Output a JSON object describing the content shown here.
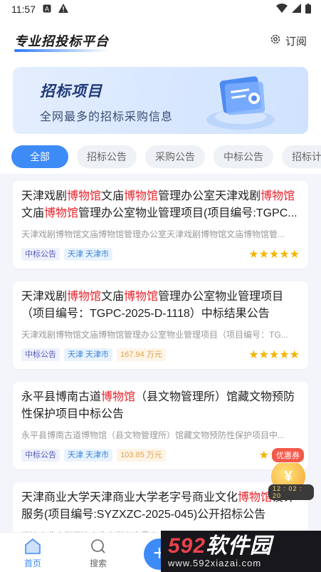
{
  "status_bar": {
    "time": "11:57"
  },
  "header": {
    "title": "专业招投标平台",
    "subscribe_label": "订阅"
  },
  "banner": {
    "title": "招标项目",
    "subtitle": "全网最多的招标采购信息"
  },
  "tabs": [
    "全部",
    "招标公告",
    "采购公告",
    "中标公告",
    "招标计"
  ],
  "cards": [
    {
      "title_parts": [
        {
          "t": "天津戏剧",
          "hl": false
        },
        {
          "t": "博物馆",
          "hl": true
        },
        {
          "t": "文庙",
          "hl": false
        },
        {
          "t": "博物馆",
          "hl": true
        },
        {
          "t": "管理办公室天津戏剧",
          "hl": false
        },
        {
          "t": "博物馆",
          "hl": true
        },
        {
          "t": "文庙",
          "hl": false
        },
        {
          "t": "博物馆",
          "hl": true
        },
        {
          "t": "管理办公室物业管理项目(项目编号:TGPC...",
          "hl": false
        }
      ],
      "desc": "天津戏剧博物馆文庙博物馆管理办公室天津戏剧博物馆文庙博物馆管...",
      "tags": [
        {
          "kind": "type",
          "text": "中标公告"
        },
        {
          "kind": "loc",
          "text": "天津 天津市"
        }
      ],
      "stars": "★★★★★"
    },
    {
      "title_parts": [
        {
          "t": "天津戏剧",
          "hl": false
        },
        {
          "t": "博物馆",
          "hl": true
        },
        {
          "t": "文庙",
          "hl": false
        },
        {
          "t": "博物馆",
          "hl": true
        },
        {
          "t": "管理办公室物业管理项目（项目编号：TGPC-2025-D-1118）中标结果公告",
          "hl": false
        }
      ],
      "desc": "天津戏剧博物馆文庙博物馆管理办公室物业管理项目（项目编号：TG...",
      "tags": [
        {
          "kind": "type",
          "text": "中标公告"
        },
        {
          "kind": "loc",
          "text": "天津 天津市"
        },
        {
          "kind": "amt",
          "text": "167.94 万元"
        }
      ],
      "stars": "★★★★★"
    },
    {
      "title_parts": [
        {
          "t": "永平县博南古道",
          "hl": false
        },
        {
          "t": "博物馆",
          "hl": true
        },
        {
          "t": "（县文物管理所）馆藏文物预防性保护项目中标公告",
          "hl": false
        }
      ],
      "desc": "永平县博南古道博物馆（县文物管理所）馆藏文物预防性保护项目中...",
      "tags": [
        {
          "kind": "type",
          "text": "中标公告"
        },
        {
          "kind": "loc",
          "text": "天津 天津市"
        },
        {
          "kind": "amt",
          "text": "103.85 万元"
        }
      ],
      "stars": "★★★★"
    },
    {
      "title_parts": [
        {
          "t": "天津商业大学天津商业大学老字号商业文化",
          "hl": false
        },
        {
          "t": "博物馆",
          "hl": true
        },
        {
          "t": "设计服务(项目编号:SYZXZC-2025-045)公开招标公告",
          "hl": false
        }
      ],
      "desc": "天津商业大学天津商业大学老字号商业文化博物馆设计服务...",
      "tags": [],
      "stars": ""
    }
  ],
  "coupon": {
    "label": "优惠券",
    "timer": "12 : 02 : 20",
    "glyph": "¥"
  },
  "bottom_nav": {
    "home": "首页",
    "search": "搜索",
    "fab": "+"
  },
  "watermark": {
    "logo_red": "592",
    "logo_white": "软件园",
    "url": "www.592xiazai.com"
  },
  "colors": {
    "accent": "#3d8bf7",
    "highlight": "#e8232b",
    "star": "#f5b400"
  }
}
